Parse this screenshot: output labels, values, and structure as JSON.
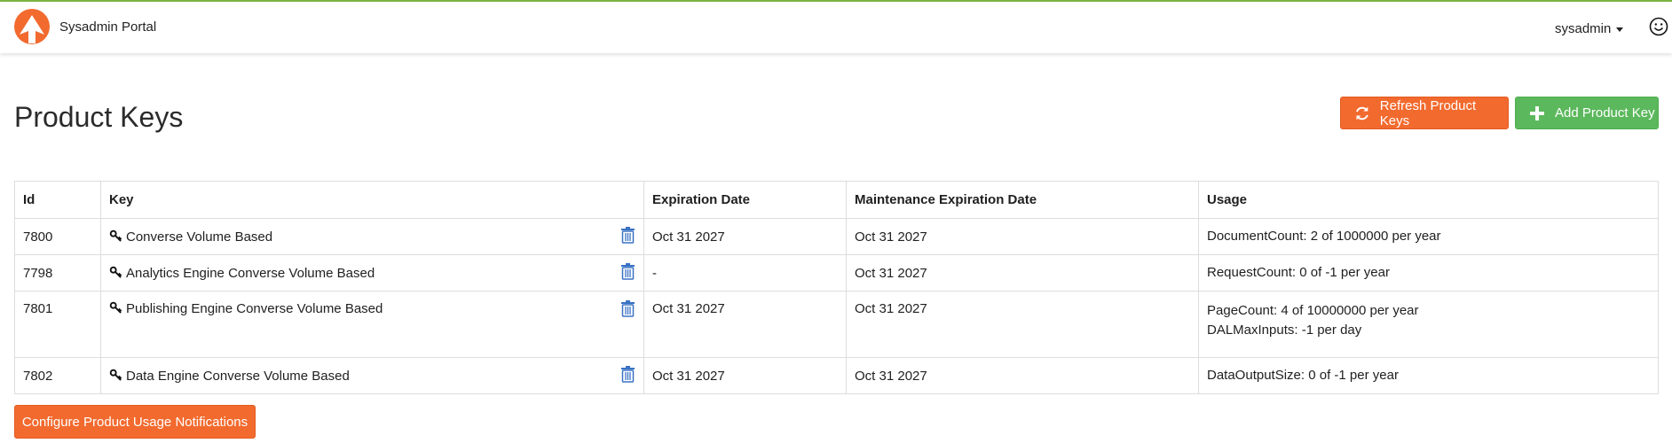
{
  "header": {
    "brand": "Sysadmin Portal",
    "user": "sysadmin",
    "accent_color": "#7cb342",
    "logo_color": "#f26a2e"
  },
  "page": {
    "title": "Product Keys"
  },
  "actions": {
    "refresh_label": "Refresh Product Keys",
    "add_label": "Add Product Key",
    "configure_label": "Configure Product Usage Notifications"
  },
  "table": {
    "headers": [
      "Id",
      "Key",
      "Expiration Date",
      "Maintenance Expiration Date",
      "Usage"
    ],
    "rows": [
      {
        "id": "7800",
        "key": "Converse Volume Based",
        "expiration": "Oct 31 2027",
        "maintenance": "Oct 31 2027",
        "usage": [
          "DocumentCount: 2 of 1000000 per year"
        ]
      },
      {
        "id": "7798",
        "key": "Analytics Engine Converse Volume Based",
        "expiration": "-",
        "maintenance": "Oct 31 2027",
        "usage": [
          "RequestCount: 0 of -1 per year"
        ]
      },
      {
        "id": "7801",
        "key": "Publishing Engine Converse Volume Based",
        "expiration": "Oct 31 2027",
        "maintenance": "Oct 31 2027",
        "usage": [
          "PageCount: 4 of 10000000 per year",
          "DALMaxInputs: -1 per day"
        ]
      },
      {
        "id": "7802",
        "key": "Data Engine Converse Volume Based",
        "expiration": "Oct 31 2027",
        "maintenance": "Oct 31 2027",
        "usage": [
          "DataOutputSize: 0 of -1 per year"
        ]
      }
    ]
  },
  "colors": {
    "orange": "#f26a2e",
    "green": "#5cb85c",
    "trash_blue": "#3a72c4"
  }
}
